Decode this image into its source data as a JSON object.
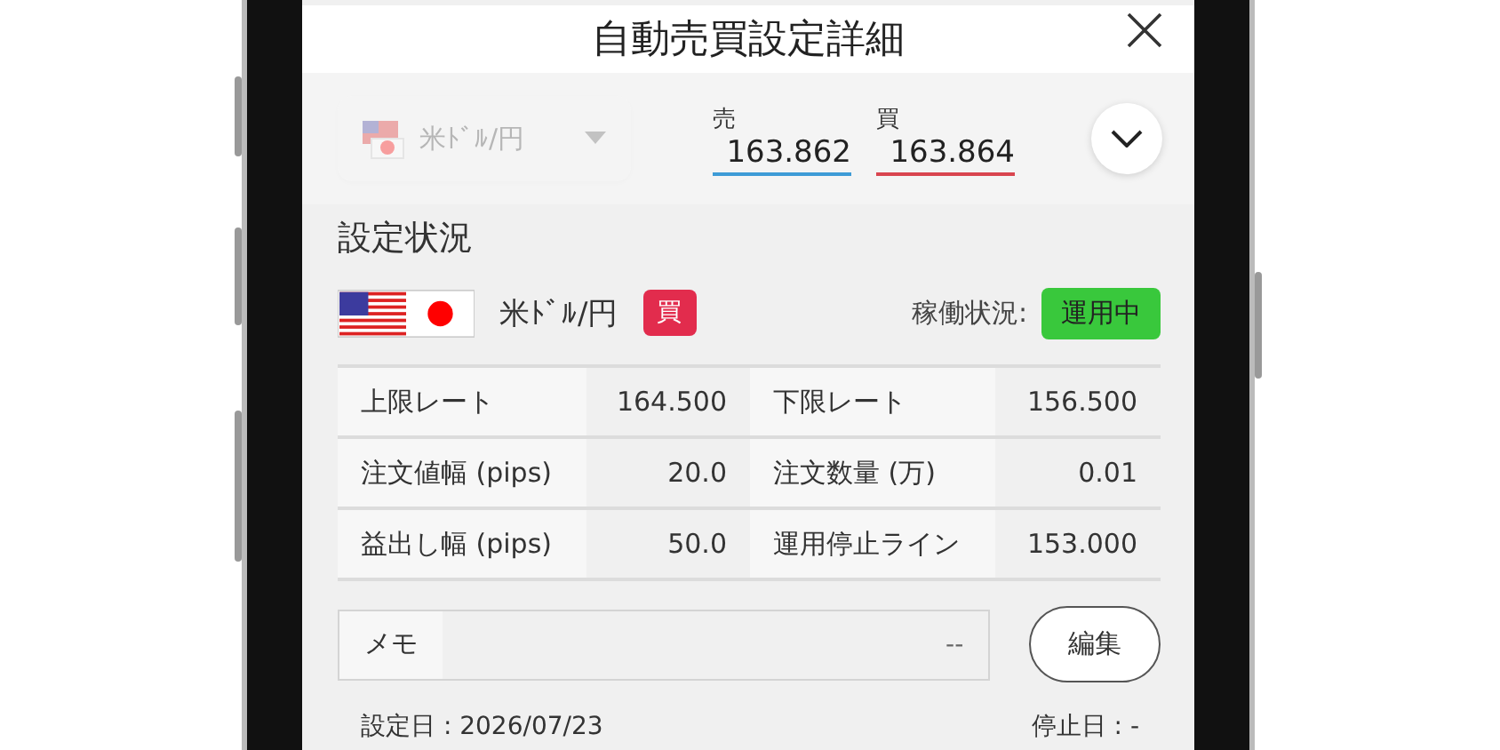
{
  "header": {
    "title": "自動売買設定詳細"
  },
  "quote_bar": {
    "pair_selector": {
      "label": "米ﾄﾞﾙ/円",
      "disabled": true
    },
    "prices": [
      {
        "kind": "sell",
        "label": "売",
        "value": "163.862"
      },
      {
        "kind": "buy",
        "label": "買",
        "value": "163.864"
      }
    ]
  },
  "settings": {
    "title": "設定状況",
    "pair": "米ﾄﾞﾙ/円",
    "side_badge": "買",
    "status_label": "稼働状況:",
    "status_badge": "運用中",
    "rows": [
      [
        {
          "label": "上限レート",
          "value": "164.500"
        },
        {
          "label": "下限レート",
          "value": "156.500"
        }
      ],
      [
        {
          "label": "注文値幅 (pips)",
          "value": "20.0"
        },
        {
          "label": "注文数量 (万)",
          "value": "0.01"
        }
      ],
      [
        {
          "label": "益出し幅 (pips)",
          "value": "50.0"
        },
        {
          "label": "運用停止ライン",
          "value": "153.000"
        }
      ]
    ],
    "memo": {
      "label": "メモ",
      "value": "--"
    },
    "edit_button": "編集",
    "set_date": "設定日 : 2026/07/23",
    "stop_date": "停止日 : -"
  }
}
